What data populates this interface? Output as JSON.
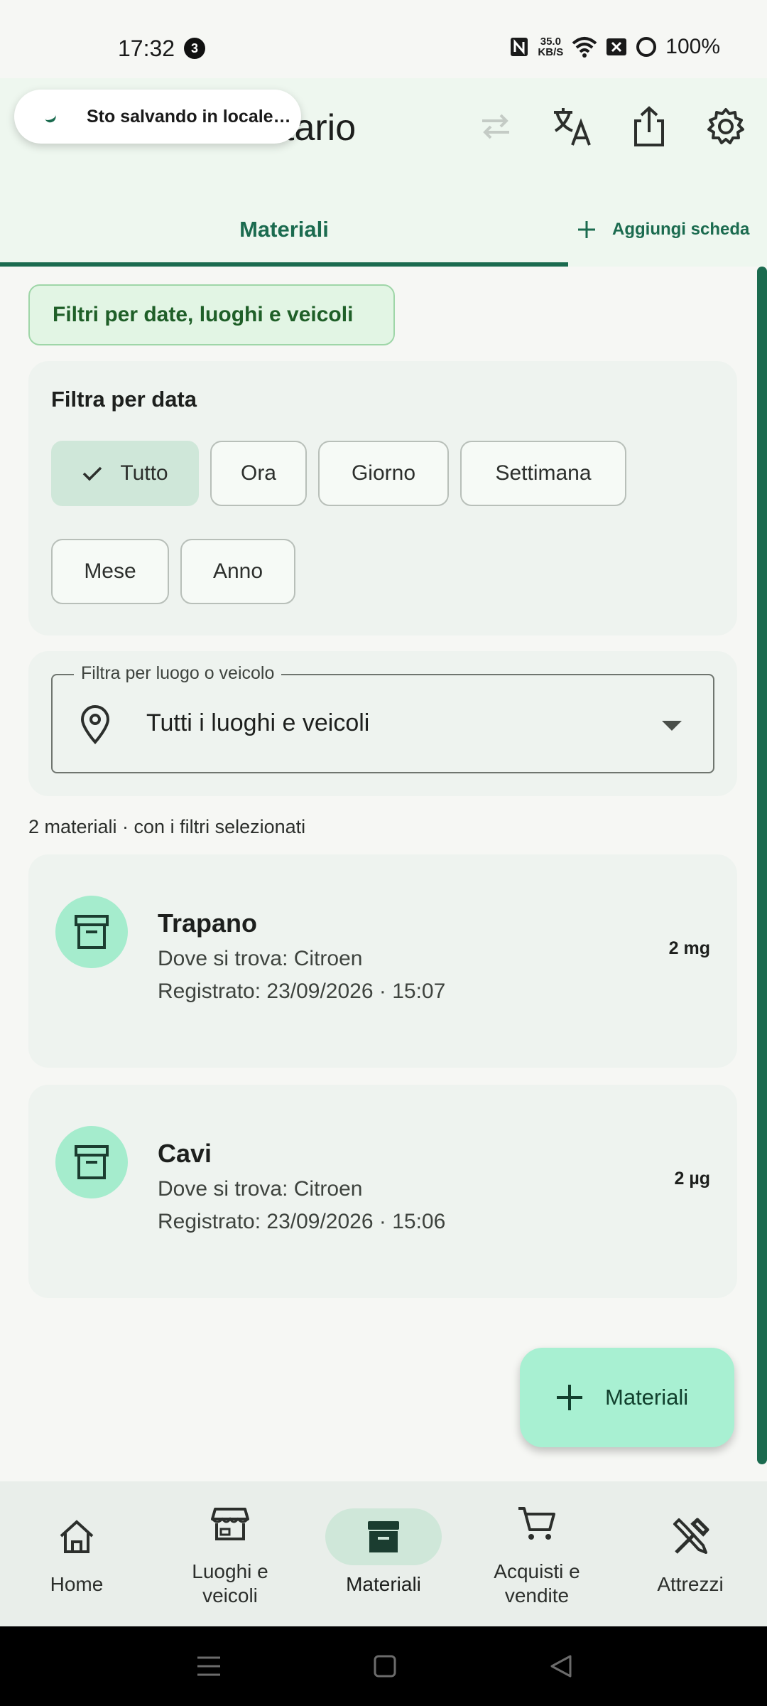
{
  "status_bar": {
    "time": "17:32",
    "notification_count": "3",
    "net_speed_value": "35.0",
    "net_speed_unit": "KB/S",
    "battery": "100%"
  },
  "app_bar": {
    "title_visible": "tario",
    "toast": "Sto salvando in locale…",
    "actions": [
      "swap-icon",
      "translate-icon",
      "share-icon",
      "settings-icon"
    ]
  },
  "tabs": {
    "active": "Materiali",
    "add_label": "Aggiungi scheda"
  },
  "filters": {
    "toggle_label": "Filtri per date, luoghi e veicoli",
    "date_title": "Filtra per data",
    "date_chips": [
      "Tutto",
      "Ora",
      "Giorno",
      "Settimana",
      "Mese",
      "Anno"
    ],
    "selected_chip": "Tutto",
    "location_legend": "Filtra per luogo o veicolo",
    "location_value": "Tutti i luoghi e veicoli"
  },
  "results_summary": "2 materiali · con i filtri selezionati",
  "items": [
    {
      "name": "Trapano",
      "location": "Dove si trova: Citroen",
      "registered": "Registrato: 23/09/2026 · 15:07",
      "quantity": "2 mg"
    },
    {
      "name": "Cavi",
      "location": "Dove si trova: Citroen",
      "registered": "Registrato: 23/09/2026 · 15:06",
      "quantity": "2 µg"
    }
  ],
  "fab_label": "Materiali",
  "bottom_nav": [
    {
      "label": "Home",
      "icon": "home-icon"
    },
    {
      "label": "Luoghi e veicoli",
      "icon": "store-icon"
    },
    {
      "label": "Materiali",
      "icon": "archive-icon"
    },
    {
      "label": "Acquisti e vendite",
      "icon": "cart-icon"
    },
    {
      "label": "Attrezzi",
      "icon": "tools-icon"
    }
  ],
  "colors": {
    "primary": "#1b6b4f",
    "app_bar_bg": "#eef7ef",
    "card_bg": "#eef3ef",
    "fab_bg": "#a8f0d2",
    "chip_selected": "#cfe7d9"
  }
}
